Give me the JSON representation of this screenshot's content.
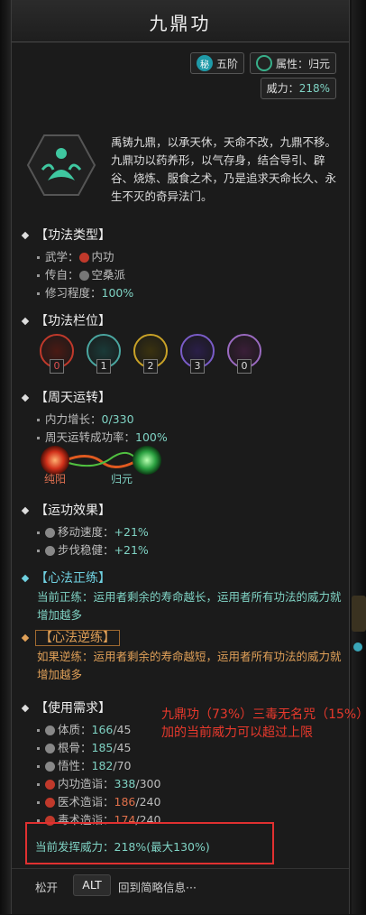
{
  "title": "九鼎功",
  "tags": {
    "secret_glyph": "秘",
    "rank": "五阶",
    "attribute": "属性：归元"
  },
  "power": {
    "label": "威力：",
    "value": "218%"
  },
  "description": "禹铸九鼎，以承天休，天命不改，九鼎不移。九鼎功以药养形，以气存身，结合导引、辟谷、烧炼、服食之术，乃是追求天命长久、永生不灭的奇异法门。",
  "type_section": {
    "header": "【功法类型】",
    "rows": [
      {
        "label": "武学：",
        "value": "内功"
      },
      {
        "label": "传自：",
        "value": "空桑派"
      },
      {
        "label": "修习程度：",
        "value": "100%"
      }
    ]
  },
  "slot_section": {
    "header": "【功法栏位】",
    "slots": [
      "0",
      "1",
      "2",
      "3",
      "0"
    ],
    "slot_colors": [
      "#c0392b",
      "#4aa6a0",
      "#c9a227",
      "#7a5cc8",
      "#9a6ac0"
    ]
  },
  "cycle_section": {
    "header": "【周天运转】",
    "rows": [
      {
        "label": "内力增长：",
        "value": "0/330"
      },
      {
        "label": "周天运转成功率：",
        "value": "100%"
      }
    ],
    "left_node": "纯阳",
    "right_node": "归元"
  },
  "effect_section": {
    "header": "【运功效果】",
    "rows": [
      {
        "label": "移动速度：",
        "value": "+21%"
      },
      {
        "label": "步伐稳健：",
        "value": "+21%"
      }
    ]
  },
  "positive_section": {
    "header": "【心法正练】",
    "text": "当前正练：运用者剩余的寿命越长，运用者所有功法的威力就增加越多"
  },
  "negative_section": {
    "header": "【心法逆练】",
    "text": "如果逆练：运用者剩余的寿命越短，运用者所有功法的威力就增加越多"
  },
  "req_section": {
    "header": "【使用需求】",
    "rows": [
      {
        "label": "体质：",
        "value": "166",
        "req": "/45",
        "ok": true
      },
      {
        "label": "根骨：",
        "value": "185",
        "req": "/45",
        "ok": true
      },
      {
        "label": "悟性：",
        "value": "182",
        "req": "/70",
        "ok": true
      },
      {
        "label": "内功造诣：",
        "value": "338",
        "req": "/300",
        "ok": true
      },
      {
        "label": "医术造诣：",
        "value": "186",
        "req": "/240",
        "ok": false
      },
      {
        "label": "毒术造诣：",
        "value": "174",
        "req": "/240",
        "ok": false
      }
    ]
  },
  "annotation": "九鼎功（73%）三毒无名咒（15%）加的当前威力可以超过上限",
  "current_power": "当前发挥威力：218%(最大130%)",
  "footer": {
    "release": "松开",
    "key": "ALT",
    "back": "回到简略信息···"
  },
  "colors": {
    "accent": "#7fd3c4",
    "warn": "#e0704a",
    "annotation": "#e8392c"
  }
}
